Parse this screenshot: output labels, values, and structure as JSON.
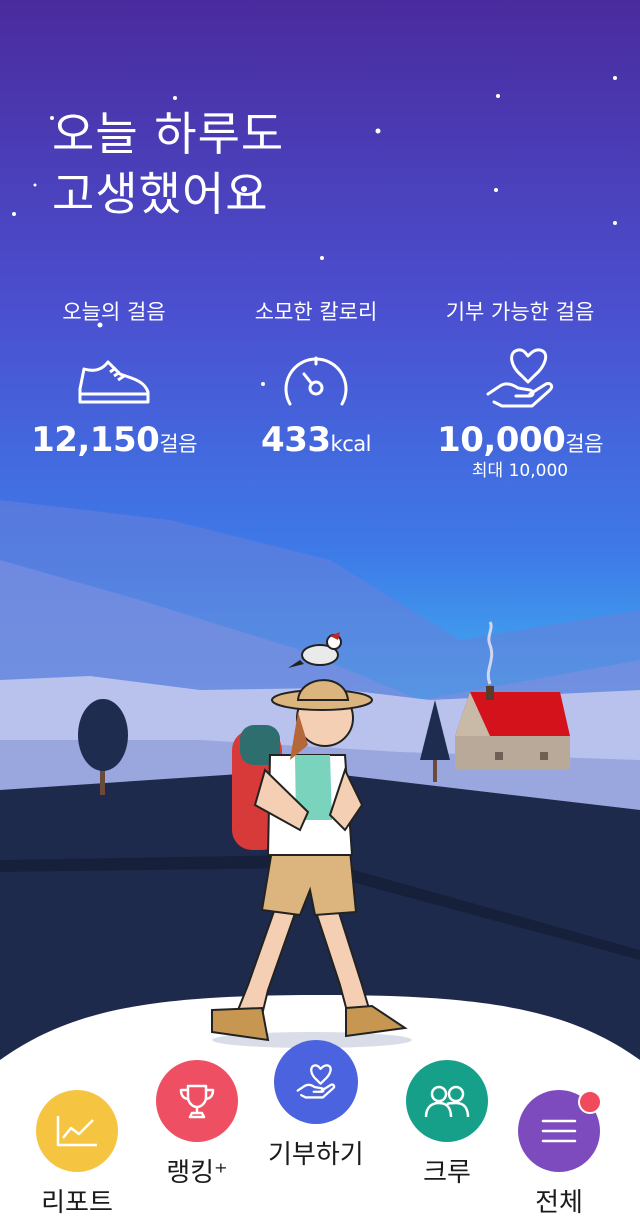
{
  "greeting": {
    "line1": "오늘 하루도",
    "line2": "고생했어요"
  },
  "stats": [
    {
      "label": "오늘의 걸음",
      "value": "12,150",
      "unit": "걸음",
      "icon": "sneaker-icon"
    },
    {
      "label": "소모한 칼로리",
      "value": "433",
      "unit": "kcal",
      "icon": "gauge-icon"
    },
    {
      "label": "기부 가능한 걸음",
      "value": "10,000",
      "unit": "걸음",
      "sub": "최대 10,000",
      "icon": "heart-hand-icon"
    }
  ],
  "nav": [
    {
      "label": "리포트",
      "icon": "chart-icon",
      "color": "#f5c542"
    },
    {
      "label": "랭킹⁺",
      "icon": "trophy-icon",
      "color": "#ee4f63"
    },
    {
      "label": "기부하기",
      "icon": "heart-hand-icon",
      "color": "#4b63de"
    },
    {
      "label": "크루",
      "icon": "people-icon",
      "color": "#16a08a"
    },
    {
      "label": "전체",
      "icon": "menu-icon",
      "color": "#7d4bbd",
      "badge": true
    }
  ],
  "colors": {
    "sky_top": "#4b2fa5",
    "sky_mid": "#3f6fe6",
    "sky_low": "#33b8f0",
    "ground": "#1e2a4c",
    "roof": "#d4121b"
  }
}
